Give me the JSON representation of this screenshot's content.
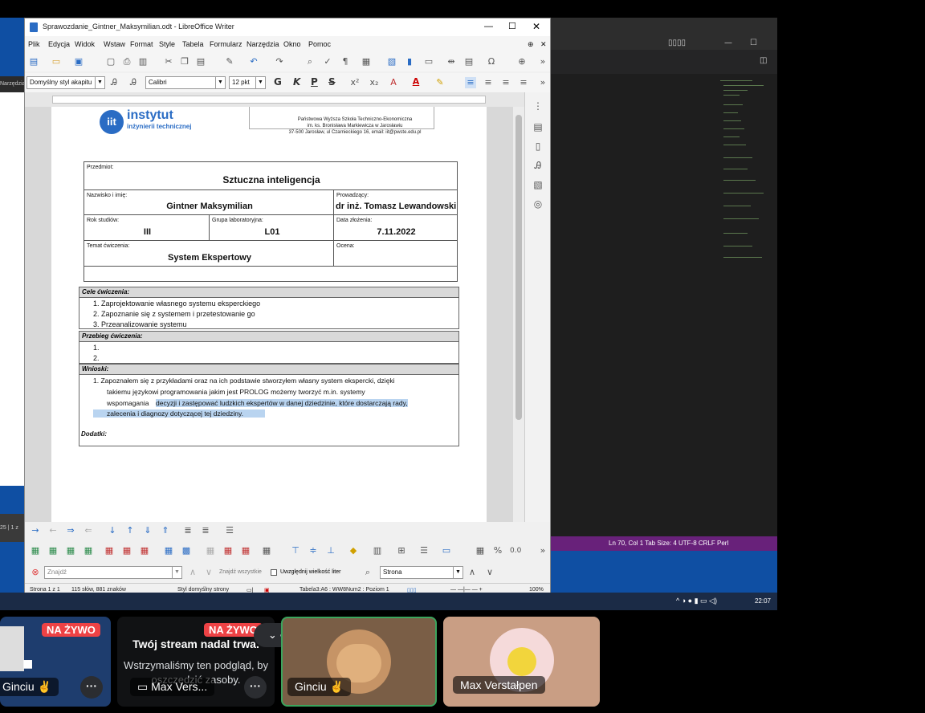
{
  "writer": {
    "window_title": "Sprawozdanie_Gintner_Maksymilian.odt - LibreOffice Writer",
    "menus": [
      "Plik",
      "Edycja",
      "Widok",
      "Wstaw",
      "Format",
      "Style",
      "Tabela",
      "Formularz",
      "Narzędzia",
      "Okno",
      "Pomoc"
    ],
    "paragraph_style": "Domyślny styl akapitu",
    "font_name": "Calibri",
    "font_size": "12 pkt",
    "format_buttons": [
      "G",
      "K",
      "P",
      "S"
    ],
    "header": {
      "logo_word1": "instytut",
      "logo_word2": "inżynierii  technicznej",
      "school_line1": "Państwowa Wyższa Szkoła Techniczno-Ekonomiczna",
      "school_line2": "im. ks. Bronisława Markiewicza w Jarosławiu",
      "school_line3": "37-500 Jarosław, ul Czarnieckiego 16, email: iit@pwste.edu.pl"
    },
    "form": {
      "subject_label": "Przedmiot:",
      "subject_value": "Sztuczna inteligencja",
      "name_label": "Nazwisko i imię:",
      "name_value": "Gintner Maksymilian",
      "teacher_label": "Prowadzący:",
      "teacher_value": "dr inż. Tomasz Lewandowski",
      "year_label": "Rok studiów:",
      "year_value": "III",
      "group_label": "Grupa laboratoryjna:",
      "group_value": "L01",
      "date_label": "Data złożenia:",
      "date_value": "7.11.2022",
      "topic_label": "Temat ćwiczenia:",
      "topic_value": "System Ekspertowy",
      "grade_label": "Ocena:"
    },
    "sections": {
      "goals_title": "Cele ćwiczenia:",
      "goals": [
        "1.   Zaprojektowanie własnego systemu eksperckiego",
        "2.   Zapoznanie się z systemem i przetestowanie go",
        "3.   Przeanalizowanie systemu"
      ],
      "course_title": "Przebieg ćwiczenia:",
      "course": [
        "1.",
        "2."
      ],
      "conclusions_title": "Wnioski:",
      "conclusion_line1": "1.    Zapoznałem się z przykładami oraz na ich podstawie stworzyłem własny system ekspercki, dzięki",
      "conclusion_line2": "takiemu językowi programowania jakim jest PROLOG możemy tworzyć m.in. systemy",
      "conclusion_line3a": "wspomagania ",
      "conclusion_line3b": "decyzji i zastępować ludzkich ekspertów w danej dziedzinie, które dostarczają rady,",
      "conclusion_line4": "zalecenia i diagnozy dotyczącej tej dziedziny.",
      "extras_title": "Dodatki:"
    },
    "find": {
      "placeholder": "Znajdź",
      "find_all": "Znajdź wszystkie",
      "match_case": "Uwzględnij wielkość liter",
      "scope": "Strona"
    },
    "status": {
      "page": "Strona 1 z 1",
      "words": "115 słów, 881 znaków",
      "page_style": "Styl domyślny strony",
      "table": "Tabela3:A6 : WW8Num2 : Poziom 1",
      "zoom": "100%"
    }
  },
  "vscode": {
    "status": "Ln 70, Col 1    Tab Size: 4    UTF-8    CRLF    Perl"
  },
  "taskbar": {
    "time": "22:07"
  },
  "left_partial": {
    "label": "Narzędzia",
    "status": "25  | 1 z"
  },
  "discord": {
    "live": "NA ŻYWO",
    "paused_title": "Twój stream nadal trwa.",
    "paused_text": "Wstrzymaliśmy ten podgląd, by oszczędzić zasoby.",
    "tiles": [
      {
        "name": "Ginciu ✌️"
      },
      {
        "name": "Max Vers..."
      },
      {
        "name": "Ginciu ✌️"
      },
      {
        "name": "Max Verstałpen"
      }
    ]
  },
  "colors": {
    "accent": "#0f4fa3",
    "live_badge": "#ed4245",
    "vscode_status": "#68217a",
    "speaking_border": "#3ba55d"
  }
}
